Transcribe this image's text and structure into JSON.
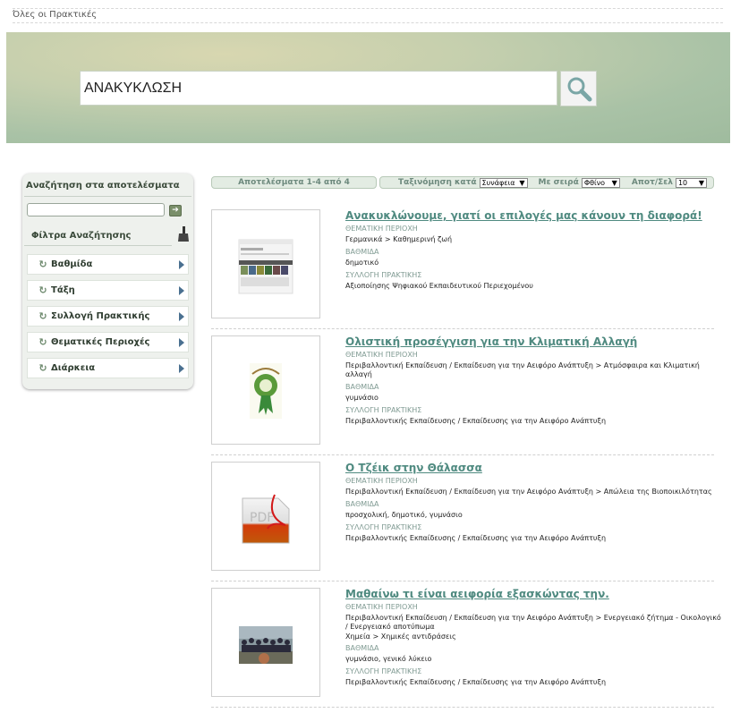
{
  "breadcrumb": "Όλες οι Πρακτικές",
  "search": {
    "value": "ΑΝΑΚΥΚΛΩΣΗ"
  },
  "sidebar": {
    "search_title": "Αναζήτηση στα αποτελέσματα",
    "search_value": "",
    "filters_title": "Φίλτρα Αναζήτησης",
    "items": [
      {
        "label": "Βαθμίδα"
      },
      {
        "label": "Τάξη"
      },
      {
        "label": "Συλλογή Πρακτικής"
      },
      {
        "label": "Θεματικές Περιοχές"
      },
      {
        "label": "Διάρκεια"
      }
    ]
  },
  "results_bar": {
    "count": "Αποτελέσματα 1-4 από 4",
    "sort_label": "Ταξινόμηση κατά",
    "sort_value": "Συνάφεια",
    "order_label": "Με σειρά",
    "order_value": "Φθίνο",
    "per_page_label": "Αποτ/Σελ",
    "per_page_value": "10"
  },
  "results": [
    {
      "title": "Ανακυκλώνουμε, γιατί οι επιλογές μας κάνουν τη διαφορά!",
      "area_label": "ΘΕΜΑΤΙΚΗ ΠΕΡΙΟΧΗ",
      "area": "Γερμανικά > Καθημερινή ζωή",
      "level_label": "ΒΑΘΜΙΔΑ",
      "level": "δημοτικό",
      "collection_label": "ΣΥΛΛΟΓΗ ΠΡΑΚΤΙΚΗΣ",
      "collection": "Αξιοποίησης Ψηφιακού Εκπαιδευτικού Περιεχομένου"
    },
    {
      "title": "Ολιστική προσέγγιση για την Κλιματική Αλλαγή",
      "area_label": "ΘΕΜΑΤΙΚΗ ΠΕΡΙΟΧΗ",
      "area": "Περιβαλλοντική Εκπαίδευση / Εκπαίδευση για την Αειφόρο Ανάπτυξη > Ατμόσφαιρα και Κλιματική αλλαγή",
      "level_label": "ΒΑΘΜΙΔΑ",
      "level": "γυμνάσιο",
      "collection_label": "ΣΥΛΛΟΓΗ ΠΡΑΚΤΙΚΗΣ",
      "collection": "Περιβαλλοντικής Εκπαίδευσης / Εκπαίδευσης για την Αειφόρο Ανάπτυξη"
    },
    {
      "title": "Ο Τζέικ στην Θάλασσα",
      "area_label": "ΘΕΜΑΤΙΚΗ ΠΕΡΙΟΧΗ",
      "area": "Περιβαλλοντική Εκπαίδευση / Εκπαίδευση για την Αειφόρο Ανάπτυξη > Απώλεια της Βιοποικιλότητας",
      "level_label": "ΒΑΘΜΙΔΑ",
      "level": "προσχολική, δημοτικό, γυμνάσιο",
      "collection_label": "ΣΥΛΛΟΓΗ ΠΡΑΚΤΙΚΗΣ",
      "collection": "Περιβαλλοντικής Εκπαίδευσης / Εκπαίδευσης για την Αειφόρο Ανάπτυξη",
      "thumb_text": "PDF"
    },
    {
      "title": "Μαθαίνω τι είναι αειφορία εξασκώντας την.",
      "area_label": "ΘΕΜΑΤΙΚΗ ΠΕΡΙΟΧΗ",
      "area": "Περιβαλλοντική Εκπαίδευση / Εκπαίδευση για την Αειφόρο Ανάπτυξη > Ενεργειακό ζήτημα - Οικολογικό / Ενεργειακό αποτύπωμα",
      "area2": "Χημεία > Χημικές αντιδράσεις",
      "level_label": "ΒΑΘΜΙΔΑ",
      "level": "γυμνάσιο, γενικό λύκειο",
      "collection_label": "ΣΥΛΛΟΓΗ ΠΡΑΚΤΙΚΗΣ",
      "collection": "Περιβαλλοντικής Εκπαίδευσης / Εκπαίδευσης για την Αειφόρο Ανάπτυξη"
    }
  ],
  "colors": {
    "accent": "#4f8a80",
    "banner": "#a9c2a6",
    "sidebar_bg": "#eef1ed"
  }
}
